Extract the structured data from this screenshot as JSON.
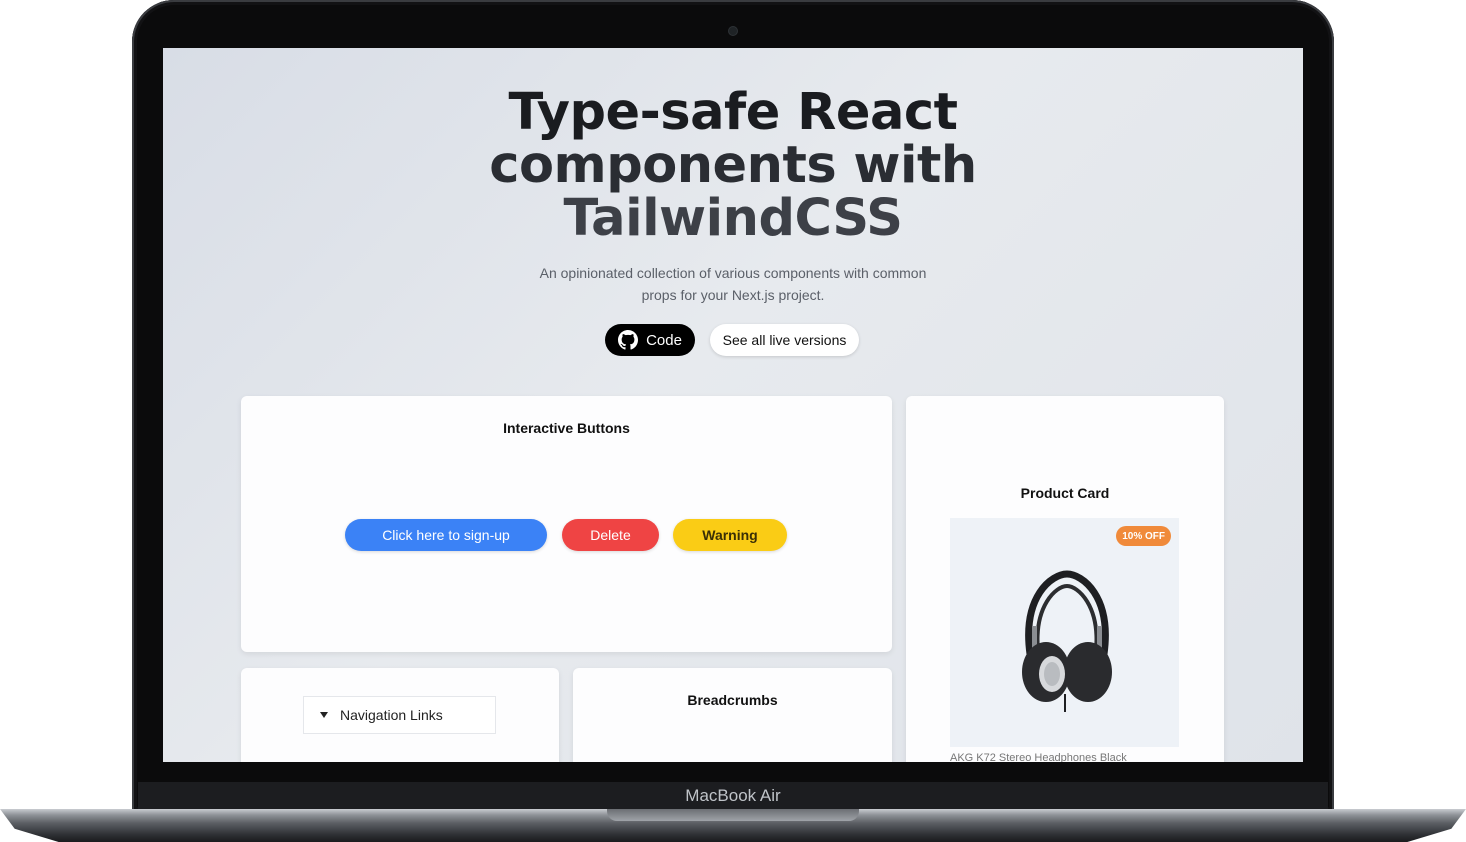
{
  "device": {
    "model_label": "MacBook Air"
  },
  "hero": {
    "title_lines": [
      "Type-safe React",
      "components with",
      "TailwindCSS"
    ],
    "subtitle": "An opinionated collection of various components with common props for your Next.js project.",
    "code_button": "Code",
    "live_button": "See all live versions"
  },
  "cards": {
    "buttons": {
      "title": "Interactive Buttons",
      "signup": "Click here to sign-up",
      "delete": "Delete",
      "warning": "Warning"
    },
    "product": {
      "title": "Product Card",
      "badge": "10% OFF",
      "name": "AKG K72 Stereo Headphones Black"
    },
    "nav": {
      "label": "Navigation Links"
    },
    "breadcrumbs": {
      "title": "Breadcrumbs"
    }
  },
  "colors": {
    "primary": "#3b82f6",
    "danger": "#ef4444",
    "warning": "#facc15",
    "badge": "#f08a3a"
  },
  "icons": [
    "github-icon",
    "caret-down-icon",
    "headphones-image"
  ]
}
